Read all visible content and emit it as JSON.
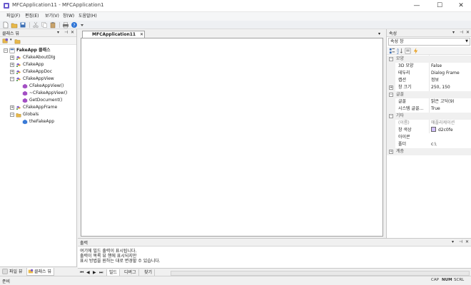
{
  "window": {
    "title": "MFCApplication11 - MFCApplication1",
    "minimize": "—",
    "maximize": "☐",
    "close": "✕"
  },
  "menu": [
    "파일(F)",
    "편집(E)",
    "보기(V)",
    "창(W)",
    "도움말(H)"
  ],
  "classview": {
    "title": "클래스 뷰",
    "pin": "ᅠ▾ ᅟ⊣ ✕",
    "tree": [
      {
        "label": "FakeApp 클래스",
        "level": 0,
        "expander": "−",
        "icon": "project-icon",
        "bold": true
      },
      {
        "label": "CFakeAboutDlg",
        "level": 1,
        "expander": "+",
        "icon": "class-icon"
      },
      {
        "label": "CFakeApp",
        "level": 1,
        "expander": "+",
        "icon": "class-icon"
      },
      {
        "label": "CFakeAppDoc",
        "level": 1,
        "expander": "+",
        "icon": "class-icon"
      },
      {
        "label": "CFakeAppView",
        "level": 1,
        "expander": "−",
        "icon": "class-icon"
      },
      {
        "label": "CFakeAppView()",
        "level": 2,
        "expander": "",
        "icon": "method-icon"
      },
      {
        "label": "~CFakeAppView()",
        "level": 2,
        "expander": "",
        "icon": "method-icon"
      },
      {
        "label": "GetDocument()",
        "level": 2,
        "expander": "",
        "icon": "method-icon"
      },
      {
        "label": "CFakeAppFrame",
        "level": 1,
        "expander": "+",
        "icon": "class-icon"
      },
      {
        "label": "Globals",
        "level": 1,
        "expander": "−",
        "icon": "folder-icon"
      },
      {
        "label": "theFakeApp",
        "level": 2,
        "expander": "",
        "icon": "variable-icon"
      }
    ],
    "tabs": [
      "파일 뷰",
      "클래스 뷰"
    ]
  },
  "document": {
    "tab_label": "MFCApplication11",
    "tab_close": "✕",
    "dropdown": "▾"
  },
  "properties": {
    "title": "속성",
    "controls": "▾ ⊣ ✕",
    "combo": "속성 창",
    "rows": [
      {
        "type": "cat",
        "exp": "−",
        "name": "모양",
        "value": ""
      },
      {
        "type": "prop",
        "name": "3D 모양",
        "value": "False"
      },
      {
        "type": "prop",
        "name": "테두리",
        "value": "Dialog Frame"
      },
      {
        "type": "prop",
        "name": "캡션",
        "value": "정보"
      },
      {
        "type": "prop",
        "exp": "+",
        "name": "창 크기",
        "value": "250, 150"
      },
      {
        "type": "cat",
        "exp": "−",
        "name": "글꼴",
        "value": ""
      },
      {
        "type": "prop",
        "name": "글꼴",
        "value": "맑은 고딕(9)"
      },
      {
        "type": "prop",
        "name": "시스템 글꼴...",
        "value": "True"
      },
      {
        "type": "cat",
        "exp": "−",
        "name": "기타",
        "value": ""
      },
      {
        "type": "prop",
        "name": "(이름)",
        "value": "애플리케이션",
        "muted": true
      },
      {
        "type": "prop",
        "name": "창 색상",
        "value": "d2c0fe",
        "swatch": "#d2c0fe"
      },
      {
        "type": "prop",
        "name": "아이콘",
        "value": ""
      },
      {
        "type": "prop",
        "name": "폴더",
        "value": "c:\\"
      },
      {
        "type": "cat",
        "exp": "+",
        "name": "계층",
        "value": ""
      }
    ]
  },
  "output": {
    "title": "출력",
    "controls": "▾ ⊣ ✕",
    "lines": [
      "여기에 빌드 출력이 표시됩니다.",
      "출력이 목록 뷰 행에 표시되지만",
      "표시 방법을 원하는 대로 변경할 수 있습니다."
    ],
    "tabs": [
      "빌드",
      "디버그",
      "찾기"
    ],
    "nav": [
      "⏮",
      "◀",
      "▶",
      "⏭"
    ]
  },
  "status": {
    "text": "준비",
    "indicators": [
      "CAP",
      "NUM",
      "SCRL"
    ]
  }
}
